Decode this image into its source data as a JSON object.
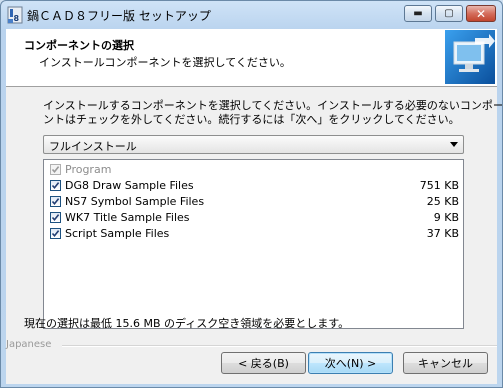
{
  "window": {
    "title": "鍋ＣＡＤ８フリー版 セットアップ",
    "min_glyph": "▬",
    "max_glyph": "▢",
    "close_glyph": "✕"
  },
  "header": {
    "title": "コンポーネントの選択",
    "subtitle": "インストールコンポーネントを選択してください。"
  },
  "description": {
    "line1": "インストールするコンポーネントを選択してください。インストールする必要のないコンポーネ",
    "line2": "ントはチェックを外してください。続行するには「次へ」をクリックしてください。"
  },
  "install_type": {
    "selected": "フルインストール"
  },
  "components": [
    {
      "label": "Program",
      "size": "",
      "checked": true,
      "disabled": true
    },
    {
      "label": "DG8 Draw Sample Files",
      "size": "751 KB",
      "checked": true,
      "disabled": false
    },
    {
      "label": "NS7 Symbol Sample Files",
      "size": "25 KB",
      "checked": true,
      "disabled": false
    },
    {
      "label": "WK7 Title Sample Files",
      "size": "9 KB",
      "checked": true,
      "disabled": false
    },
    {
      "label": "Script Sample Files",
      "size": "37 KB",
      "checked": true,
      "disabled": false
    }
  ],
  "space_required": "現在の選択は最低 15.6 MB のディスク空き領域を必要とします。",
  "language": "Japanese",
  "buttons": {
    "back": "< 戻る(B)",
    "next": "次へ(N) >",
    "cancel": "キャンセル"
  }
}
